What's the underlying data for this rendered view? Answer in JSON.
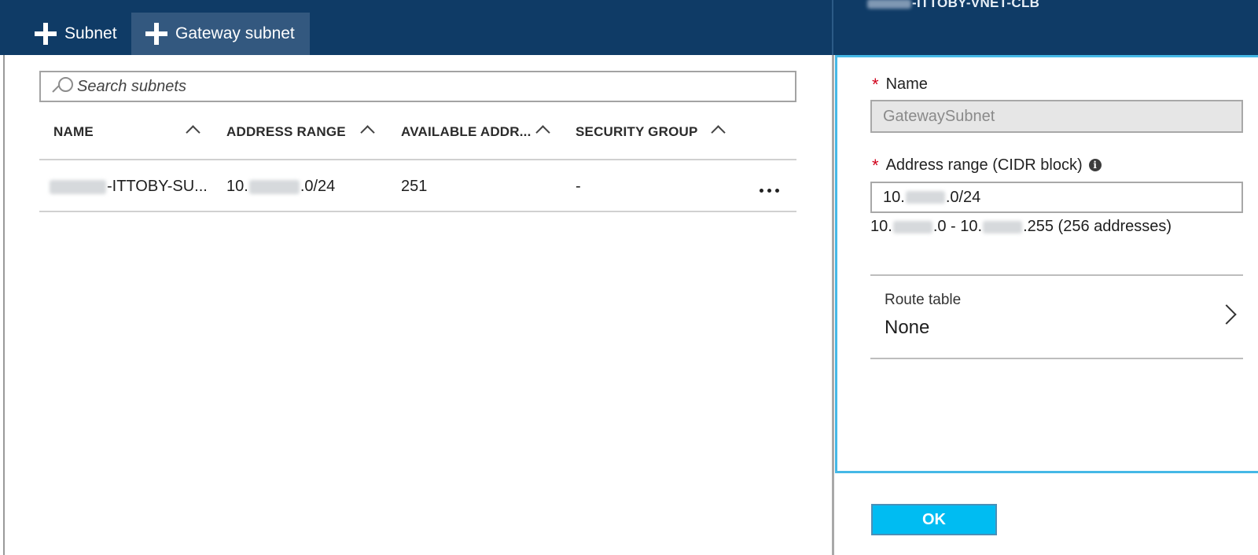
{
  "toolbar": {
    "subnet_label": "Subnet",
    "gateway_subnet_label": "Gateway subnet"
  },
  "blade_title": {
    "suffix": "-ITTOBY-VNET-CLB"
  },
  "search": {
    "placeholder": "Search subnets",
    "value": ""
  },
  "table": {
    "columns": [
      {
        "label": "NAME"
      },
      {
        "label": "ADDRESS RANGE"
      },
      {
        "label": "AVAILABLE ADDR..."
      },
      {
        "label": "SECURITY GROUP"
      }
    ],
    "rows": [
      {
        "name_suffix": "-ITTOBY-SU...",
        "address_prefix": "10.",
        "address_suffix": ".0/24",
        "available": "251",
        "security_group": "-",
        "more": "..."
      }
    ]
  },
  "form": {
    "name": {
      "required_mark": "*",
      "label": "Name",
      "value": "GatewaySubnet"
    },
    "cidr": {
      "required_mark": "*",
      "label": "Address range (CIDR block)",
      "info_glyph": "i",
      "value_prefix": "10.",
      "value_suffix": ".0/24",
      "range_start_prefix": "10.",
      "range_start_suffix": ".0 - 10.",
      "range_end_suffix": ".255 (256 addresses)"
    },
    "route_table": {
      "label": "Route table",
      "value": "None"
    },
    "ok_label": "OK"
  },
  "colors": {
    "header_bg": "#0f3b66",
    "active_command_bg": "#33587f",
    "blade_border": "#45b8e6",
    "ok_button": "#00bcf2",
    "required_mark": "#d0021b"
  },
  "icons": {
    "add": "plus-icon",
    "search": "search-icon",
    "sort": "chevron-up-icon",
    "more": "ellipsis-icon",
    "info": "info-icon",
    "navigate": "chevron-right-icon"
  }
}
